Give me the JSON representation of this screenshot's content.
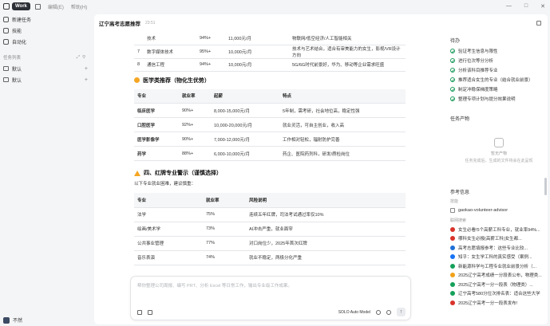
{
  "topbar": {
    "work_label": "Work",
    "menu_items": [
      "编辑(E)",
      "帮助(H)"
    ],
    "window_controls": [
      "—",
      "□",
      "✕"
    ]
  },
  "sidebar": {
    "new_task": "新建任务",
    "skills": "技能",
    "automation": "自动化",
    "task_list_label": "任务列表",
    "groups": [
      "默认",
      "默认"
    ],
    "user_name": "不然"
  },
  "main": {
    "title": "辽宁高考志愿推荐",
    "time": "23:51",
    "table1_rows": [
      [
        "",
        "技术",
        "94%+",
        "11,000元/月",
        "物联网/低空经济/人工智能相关",
        ""
      ],
      [
        "7",
        "数字媒体技术",
        "95%+",
        "10,000元/月",
        "技术与艺术结合，适合有审美能力的女生，影视/VR设计方向",
        ""
      ],
      [
        "8",
        "通信工程",
        "94%+",
        "10,000元/月",
        "5G/6G时代前景好，华为、移动等企业需求旺盛",
        ""
      ]
    ],
    "section1_title": "医学类推荐（物化生优势）",
    "table2": {
      "headers": [
        "专业",
        "就业率",
        "起薪",
        "特点"
      ],
      "rows": [
        [
          "临床医学",
          "90%+",
          "8,000-15,000元/月",
          "5年制，需考研，社会地位高，稳定性强"
        ],
        [
          "口腔医学",
          "92%+",
          "10,000-20,000元/月",
          "就业灵活，可自主创业，收入高"
        ],
        [
          "医学影像学",
          "90%+",
          "7,000-12,000元/月",
          "工作相对轻松，辐射防护完善"
        ],
        [
          "药学",
          "88%+",
          "6,000-10,000元/月",
          "药企、医院药剂科，研发/质检岗位"
        ]
      ]
    },
    "section2_title": "四、红牌专业警示（谨慎选择）",
    "section2_note": "以下专业就业困难，建议慎重：",
    "table3": {
      "headers": [
        "专业",
        "就业率",
        "风险说明"
      ],
      "rows": [
        [
          "法学",
          "75%",
          "连续五年红牌，司法考试通过率仅10%"
        ],
        [
          "绘画/美术学",
          "73%",
          "AI冲击严重，就业面窄"
        ],
        [
          "公共事业管理",
          "77%",
          "对口岗位少，2025年首次红牌"
        ],
        [
          "音乐表演",
          "74%",
          "就业不稳定，两极分化严重"
        ]
      ]
    },
    "input_placeholder": "帮你整理公司周报、编写 PRT、分析 Excel 等日常工作，输出专业级工作成果。",
    "model_label": "SOLO Auto Model"
  },
  "right_panel": {
    "todo_title": "待办",
    "todos": [
      "验证考生信息与限性",
      "进行位次等分分析",
      "分析该科目推荐专业",
      "推荐适合女生的专业（结合就业前景）",
      "制定冲稳保梯度策略",
      "整理专项计划与提分效果说明"
    ],
    "artifacts_title": "任务产物",
    "artifacts_empty": "暂无产物",
    "artifacts_hint": "任务完成后，生成的文件将会在此呈现",
    "ref_title": "参考信息",
    "skills_label": "技能",
    "skill_name": "gaokao-volunteer-advisor",
    "links_label": "联网搜索",
    "links": [
      {
        "text": "女生必看!5个高薪工科专业，就业率94%...",
        "color": "#d9332b"
      },
      {
        "text": "哪科女生必报(高薪工科)女生都...",
        "color": "#d9332b"
      },
      {
        "text": "高考志愿填报参考：这些专业比较...",
        "color": "#1f6fd6"
      },
      {
        "text": "知乎：女生学工科的真实感受（案例...",
        "color": "#1772f6"
      },
      {
        "text": "新能源科学与工程专业就业前景分析（...",
        "color": "#14a05a"
      },
      {
        "text": "2025辽宁高考成绩一分段表公布，物理类...",
        "color": "#f0a21a"
      },
      {
        "text": "2025辽宁高考一分一段表（物理类）...",
        "color": "#14a05a"
      },
      {
        "text": "辽宁高考580分位次排名表：适合这些大学",
        "color": "#14a05a"
      },
      {
        "text": "2025辽宁高考一分一段表发布!",
        "color": "#d9332b"
      }
    ]
  }
}
